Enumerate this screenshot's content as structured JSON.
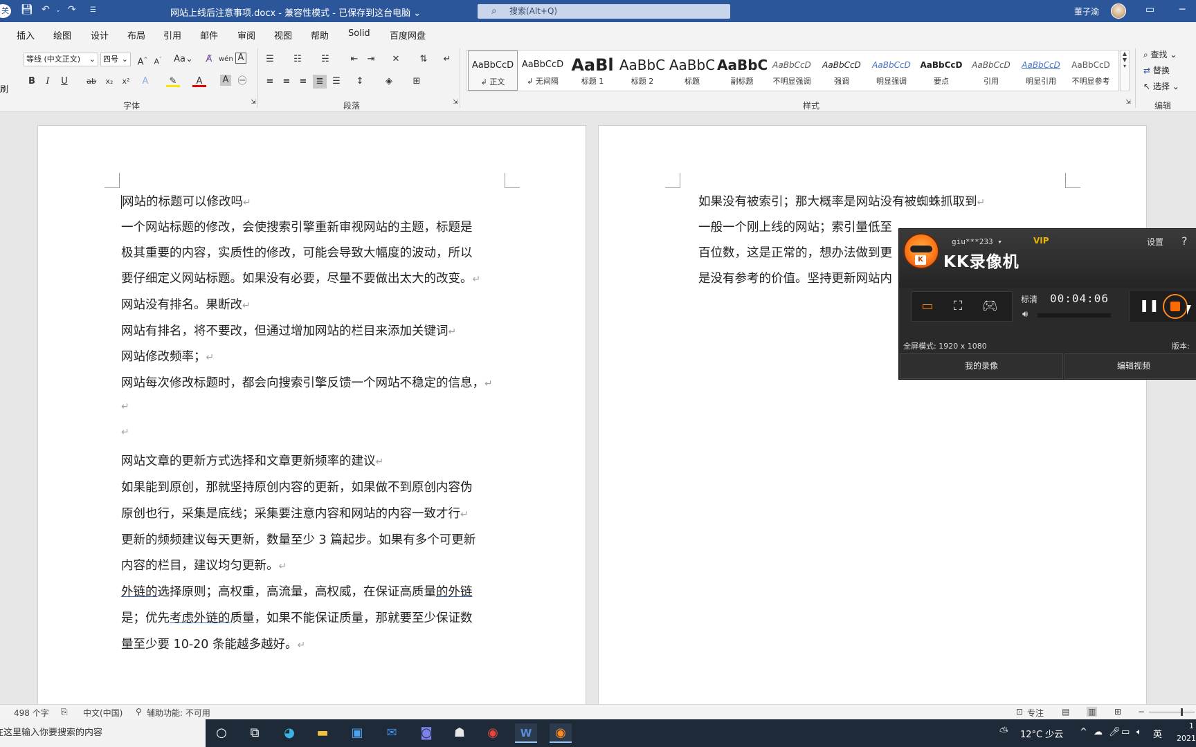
{
  "window": {
    "doc_title": "网站上线后注意事项.docx  -  兼容性模式 - 已保存到这台电脑 ⌄",
    "search_placeholder": "搜索(Alt+Q)",
    "user_name": "董子渝",
    "left_badge": "关"
  },
  "tabs": [
    "插入",
    "绘图",
    "设计",
    "布局",
    "引用",
    "邮件",
    "审阅",
    "视图",
    "帮助",
    "Solid",
    "百度网盘"
  ],
  "ribbon": {
    "font_name": "等线 (中文正文)",
    "font_size": "四号",
    "group_font": "字体",
    "group_paragraph": "段落",
    "group_styles": "样式",
    "group_edit": "编辑",
    "left_stub": "刷",
    "styles": [
      {
        "preview": "AaBbCcD",
        "name": "↲ 正文"
      },
      {
        "preview": "AaBbCcD",
        "name": "↲ 无间隔"
      },
      {
        "preview": "AaBl",
        "name": "标题 1"
      },
      {
        "preview": "AaBbC",
        "name": "标题 2"
      },
      {
        "preview": "AaBbC",
        "name": "标题"
      },
      {
        "preview": "AaBbC",
        "name": "副标题"
      },
      {
        "preview": "AaBbCcD",
        "name": "不明显强调"
      },
      {
        "preview": "AaBbCcD",
        "name": "强调"
      },
      {
        "preview": "AaBbCcD",
        "name": "明显强调"
      },
      {
        "preview": "AaBbCcD",
        "name": "要点"
      },
      {
        "preview": "AaBbCcD",
        "name": "引用"
      },
      {
        "preview": "AaBbCcD",
        "name": "明显引用"
      },
      {
        "preview": "AaBbCcD",
        "name": "不明显参考"
      }
    ],
    "find": "查找",
    "replace": "替换",
    "select": "选择"
  },
  "page1": [
    "网站的标题可以修改吗",
    "一个网站标题的修改，会使搜索引擎重新审视网站的主题，标题是",
    "极其重要的内容，实质性的修改，可能会导致大幅度的波动，所以",
    "要仔细定义网站标题。如果没有必要，尽量不要做出太大的改变。",
    "网站没有排名。果断改",
    "网站有排名，将不要改，但通过增加网站的栏目来添加关键词",
    "网站修改频率；",
    "网站每次修改标题时，都会向搜索引擎反馈一个网站不稳定的信息，",
    "",
    "",
    "网站文章的更新方式选择和文章更新频率的建议",
    "如果能到原创，那就坚持原创内容的更新，如果做不到原创内容伪",
    "原创也行，采集是底线；采集要注意内容和网站的内容一致才行",
    "更新的频频建议每天更新，数量至少 3 篇起步。如果有多个可更新",
    "内容的栏目，建议均匀更新。",
    "外链的选择原则；高权重，高流量，高权威，在保证高质量的外链",
    "是；优先考虑外链的质量，如果不能保证质量，那就要至少保证数",
    "量至少要 10-20 条能越多越好。"
  ],
  "page2": [
    "如果没有被索引；那大概率是网站没有被蜘蛛抓取到",
    "一般一个刚上线的网站；索引量低至",
    "百位数，这是正常的，想办法做到更",
    "是没有参考的价值。坚持更新网站内"
  ],
  "para_mark": "↵",
  "recorder": {
    "user": "giu***233",
    "vip": "VIP",
    "settings": "设置",
    "help": "?",
    "brand": "KK录像机",
    "quality": "标清",
    "timer": "00:04:06",
    "info": "全屏模式: 1920 x 1080",
    "version": "版本:",
    "btn_my": "我的录像",
    "btn_edit": "编辑视频"
  },
  "status": {
    "words": "498 个字",
    "lang": "中文(中国)",
    "access": "辅助功能: 不可用",
    "focus": "专注"
  },
  "taskbar": {
    "search": "在这里输入你要搜索的内容",
    "weather": "12°C  少云",
    "ime": "英",
    "time": "1",
    "date": "2021"
  }
}
